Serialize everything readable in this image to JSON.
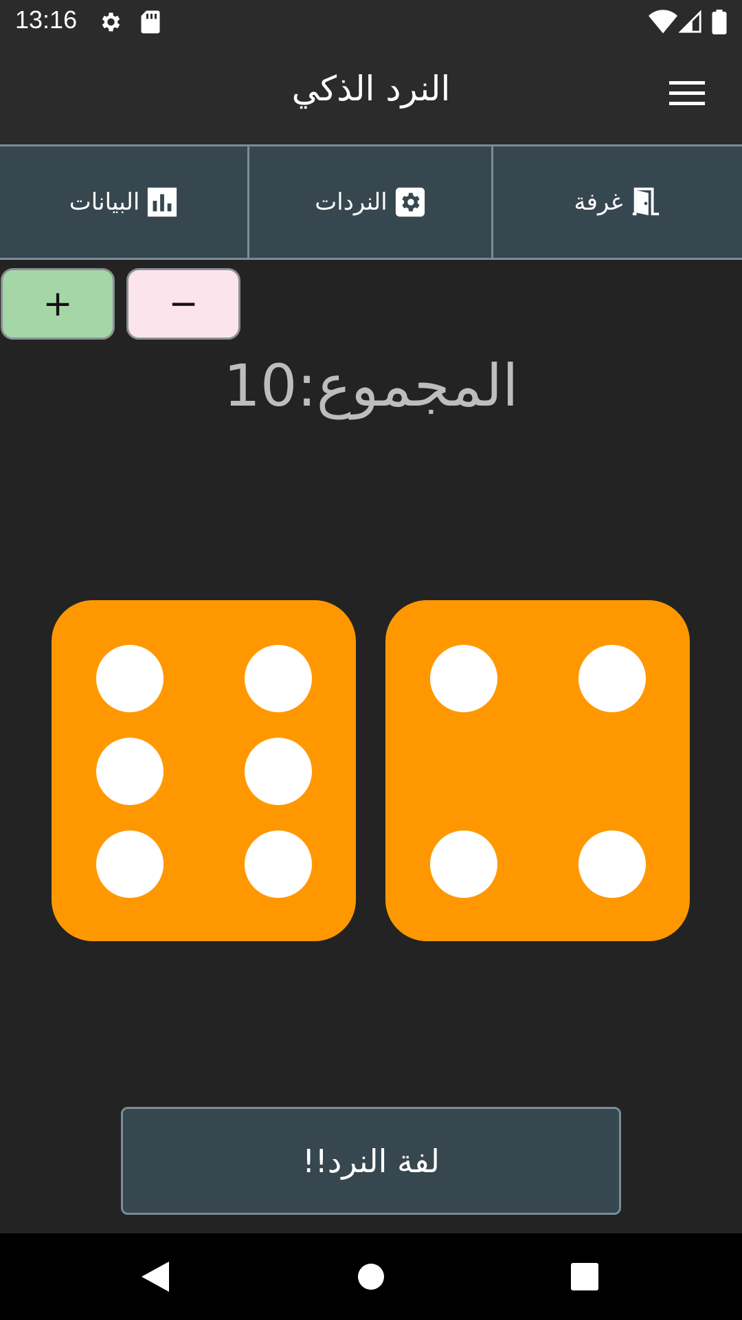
{
  "status_bar": {
    "time": "13:16"
  },
  "app_bar": {
    "title": "النرد الذكي"
  },
  "tabs": [
    {
      "label": "غرفة",
      "icon": "door-icon"
    },
    {
      "label": "النردات",
      "icon": "dice-settings-icon"
    },
    {
      "label": "البيانات",
      "icon": "bar-chart-icon"
    }
  ],
  "stepper": {
    "plus_label": "+",
    "minus_label": "−"
  },
  "total": {
    "text": "المجموع:10",
    "value": 10
  },
  "dice": [
    {
      "value": 6
    },
    {
      "value": 4
    }
  ],
  "colors": {
    "die": "#ff9800",
    "pip": "#ffffff",
    "plus": "#a5d6a7",
    "minus": "#fce4ec",
    "tab_bg": "#37474f"
  },
  "roll_button": {
    "label": "لفة النرد!!"
  }
}
